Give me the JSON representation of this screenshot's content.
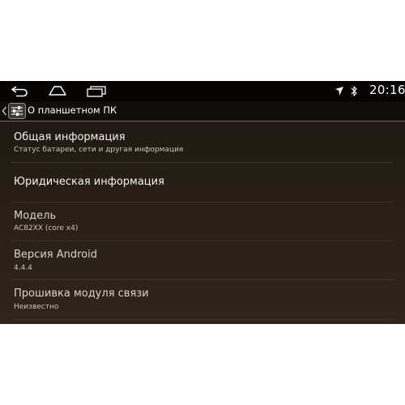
{
  "status_bar": {
    "time": "20:16",
    "nav_icons": [
      "back-icon",
      "home-icon",
      "recent-apps-icon"
    ],
    "status_icons": [
      "signal-icon",
      "bluetooth-icon"
    ]
  },
  "action_bar": {
    "title": "О планшетном ПК",
    "icon": "settings-sliders-icon"
  },
  "items": [
    {
      "title": "Общая информация",
      "subtitle": "Статус батареи, сети и другая информация"
    },
    {
      "title": "Юридическая информация"
    },
    {
      "title": "Модель",
      "subtitle": "AC82XX (core x4)"
    },
    {
      "title": "Версия Android",
      "subtitle": "4.4.4"
    },
    {
      "title": "Прошивка модуля связи",
      "subtitle": "Неизвестно"
    }
  ],
  "colors": {
    "accent": "#8a6d2c",
    "background_top": "#1c1712",
    "background_bottom": "#2f251b"
  }
}
